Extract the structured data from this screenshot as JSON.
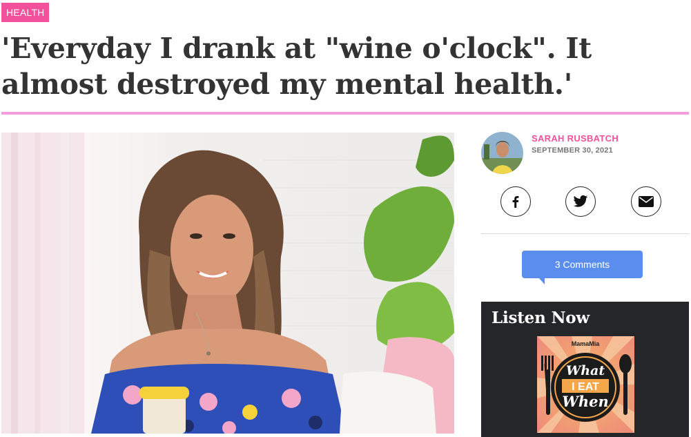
{
  "article": {
    "category": "HEALTH",
    "title": "'Everyday I drank at \"wine o'clock\". It almost destroyed my mental health.'"
  },
  "author": {
    "name": "SARAH RUSBATCH",
    "date": "SEPTEMBER 30, 2021"
  },
  "share": {
    "icons": [
      "facebook-icon",
      "twitter-icon",
      "email-icon"
    ]
  },
  "comments": {
    "label": "3 Comments"
  },
  "sidebar": {
    "listen_title": "Listen Now",
    "podcast": {
      "brand": "MamaMia",
      "line1": "What",
      "line2": "I EAT",
      "line3": "When"
    }
  },
  "colors": {
    "brand_pink": "#f2519c",
    "rule_pink": "#f39ddc",
    "comments_blue": "#5b8def",
    "panel_dark": "#25262a"
  }
}
